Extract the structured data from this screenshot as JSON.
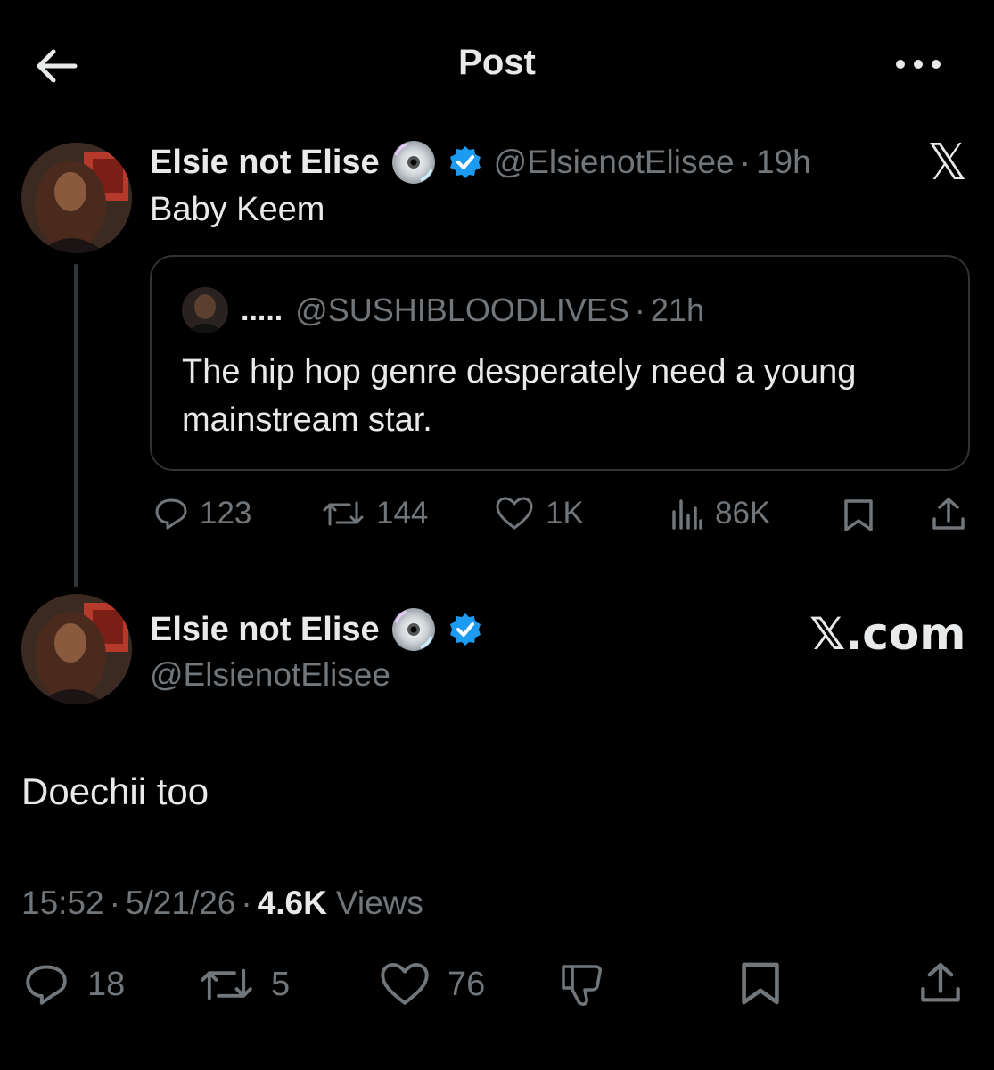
{
  "header": {
    "title": "Post"
  },
  "tweet1": {
    "name": "Elsie not Elise",
    "handle": "@ElsienotElisee",
    "separator": "·",
    "time": "19h",
    "text": "Baby Keem",
    "watermark": "𝕏",
    "quote": {
      "name": ".....",
      "handle": "@SUSHIBLOODLIVES",
      "time": "21h",
      "text": "The hip hop genre desperately need a young mainstream star."
    },
    "actions": {
      "replies": "123",
      "reposts": "144",
      "likes": "1K",
      "views": "86K"
    }
  },
  "tweet2": {
    "name": "Elsie not Elise",
    "handle": "@ElsienotElisee",
    "watermark": "𝕏.com",
    "text": "Doechii too",
    "meta": {
      "time": "15:52",
      "date": "5/21/26",
      "views_count": "4.6K",
      "views_label": "Views",
      "separator": "·"
    },
    "actions": {
      "replies": "18",
      "reposts": "5",
      "likes": "76"
    }
  },
  "colors": {
    "background": "#000000",
    "text": "#e7e9ea",
    "secondary": "#71767b",
    "verified": "#1d9bf0",
    "border": "#2f3336"
  },
  "icons": [
    "back-arrow-icon",
    "more-icon",
    "cd-disc-icon",
    "verified-badge-icon",
    "x-logo-icon",
    "reply-icon",
    "repost-icon",
    "like-icon",
    "views-icon",
    "bookmark-icon",
    "share-icon",
    "dislike-icon"
  ]
}
